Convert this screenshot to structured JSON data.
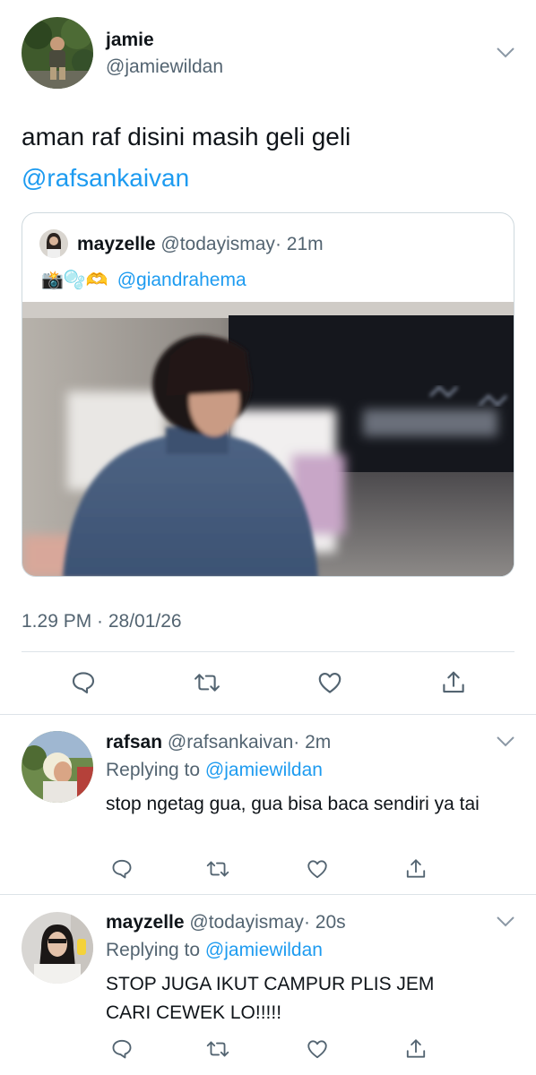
{
  "tweet": {
    "name": "jamie",
    "handle": "@jamiewildan",
    "text": "aman raf disini masih geli geli",
    "mention": "@rafsankaivan",
    "timestamp": "1.29 PM · 28/01/26"
  },
  "quote": {
    "name": "mayzelle",
    "handle": "@todayismay",
    "time": "· 21m",
    "emojis": "📸🫧🫶",
    "mention": "@giandrahema"
  },
  "replies": [
    {
      "name": "rafsan",
      "handle": "@rafsankaivan",
      "time": "· 2m",
      "replying_to_label": "Replying to",
      "replying_to": "@jamiewildan",
      "text": "stop ngetag gua, gua bisa baca sendiri ya tai"
    },
    {
      "name": "mayzelle",
      "handle": "@todayismay",
      "time": "· 20s",
      "replying_to_label": "Replying to",
      "replying_to": "@jamiewildan",
      "text": "STOP JUGA IKUT CAMPUR PLIS JEM CARI CEWEK LO!!!!!"
    }
  ],
  "icons": {
    "reply": "reply-icon",
    "retweet": "retweet-icon",
    "like": "heart-icon",
    "share": "share-icon",
    "more": "chevron-down-icon"
  },
  "colors": {
    "link": "#1d9bf0",
    "secondary_text": "#536471",
    "divider": "#dde3e8"
  }
}
